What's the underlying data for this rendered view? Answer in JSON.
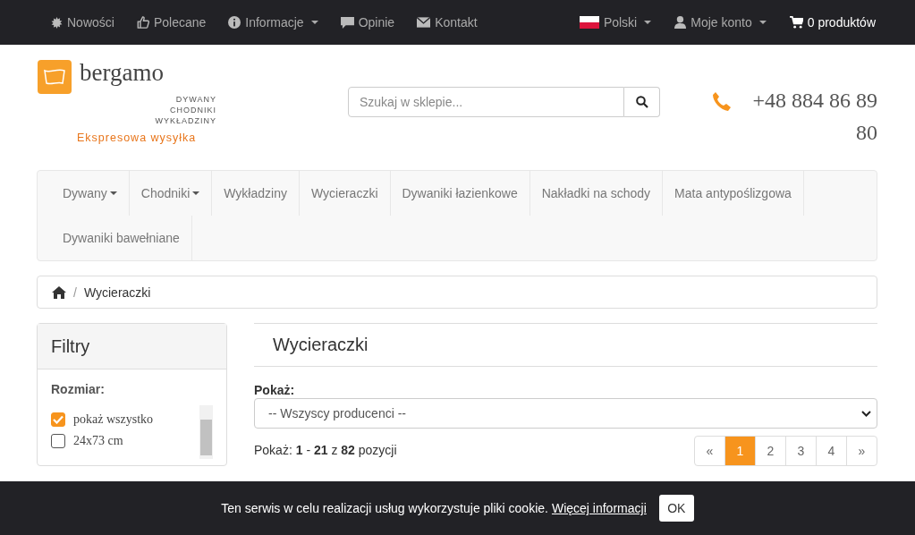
{
  "top_bar": {
    "left_links": [
      {
        "label": "Nowości",
        "dropdown": false
      },
      {
        "label": "Polecane",
        "dropdown": false
      },
      {
        "label": "Informacje",
        "dropdown": true
      },
      {
        "label": "Opinie",
        "dropdown": false
      },
      {
        "label": "Kontakt",
        "dropdown": false
      }
    ],
    "language": {
      "label": "Polski"
    },
    "account": {
      "label": "Moje konto"
    },
    "cart": {
      "label": "0 produktów"
    }
  },
  "logo": {
    "name": "bergamo",
    "lines": [
      "DYWANY",
      "CHODNIKI",
      "WYKŁADZINY"
    ],
    "tagline": "Ekspresowa wysyłka"
  },
  "search": {
    "placeholder": "Szukaj w sklepie..."
  },
  "phone": {
    "number": "+48 884 86 89 80"
  },
  "category_nav": [
    {
      "label": "Dywany",
      "dropdown": true
    },
    {
      "label": "Chodniki",
      "dropdown": true
    },
    {
      "label": "Wykładziny",
      "dropdown": false
    },
    {
      "label": "Wycieraczki",
      "dropdown": false
    },
    {
      "label": "Dywaniki łazienkowe",
      "dropdown": false
    },
    {
      "label": "Nakładki na schody",
      "dropdown": false
    },
    {
      "label": "Mata antypoślizgowa",
      "dropdown": false
    },
    {
      "label": "Dywaniki bawełniane",
      "dropdown": false
    }
  ],
  "breadcrumb": {
    "separator": "/",
    "items": [
      "Wycieraczki"
    ]
  },
  "filters": {
    "title": "Filtry",
    "group": "Rozmiar:",
    "options": [
      {
        "label": "pokaż wszystko",
        "checked": true
      },
      {
        "label": "24x73 cm",
        "checked": false
      }
    ]
  },
  "main": {
    "title": "Wycieraczki",
    "show_label": "Pokaż:",
    "manufacturer_select": "-- Wszyscy producenci --",
    "summary": "Pokaż: **1** - **21** z **82** pozycji",
    "pagination": [
      {
        "label": "«",
        "selected": false
      },
      {
        "label": "1",
        "selected": true
      },
      {
        "label": "2",
        "selected": false
      },
      {
        "label": "3",
        "selected": false
      },
      {
        "label": "4",
        "selected": false
      },
      {
        "label": "»",
        "selected": false
      }
    ]
  },
  "cookie_bar": {
    "text": "Ten serwis w celu realizacji usług wykorzystuje pliki cookie.",
    "link": "Więcej informacji",
    "button": "OK"
  }
}
